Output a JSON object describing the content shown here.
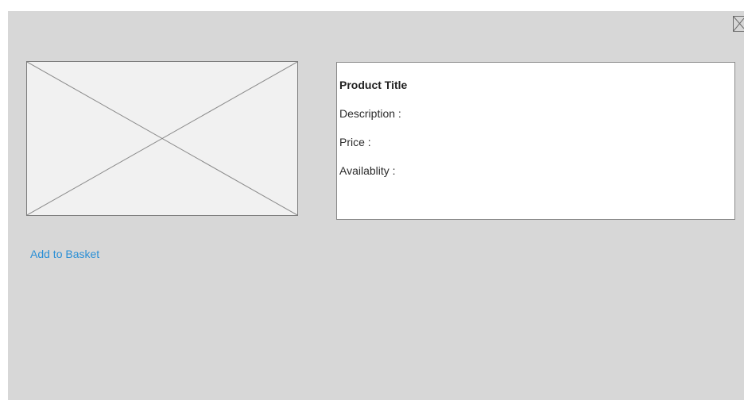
{
  "product": {
    "title": "Product Title",
    "description_label": "Description :",
    "price_label": "Price :",
    "availability_label": "Availablity :"
  },
  "actions": {
    "add_to_basket": "Add to Basket"
  },
  "icons": {
    "close": "close-icon",
    "image_placeholder": "image-placeholder-icon"
  },
  "colors": {
    "modal_background": "#d7d7d7",
    "link": "#2a8fd6",
    "panel_background": "#ffffff",
    "placeholder_background": "#f1f1f1"
  }
}
